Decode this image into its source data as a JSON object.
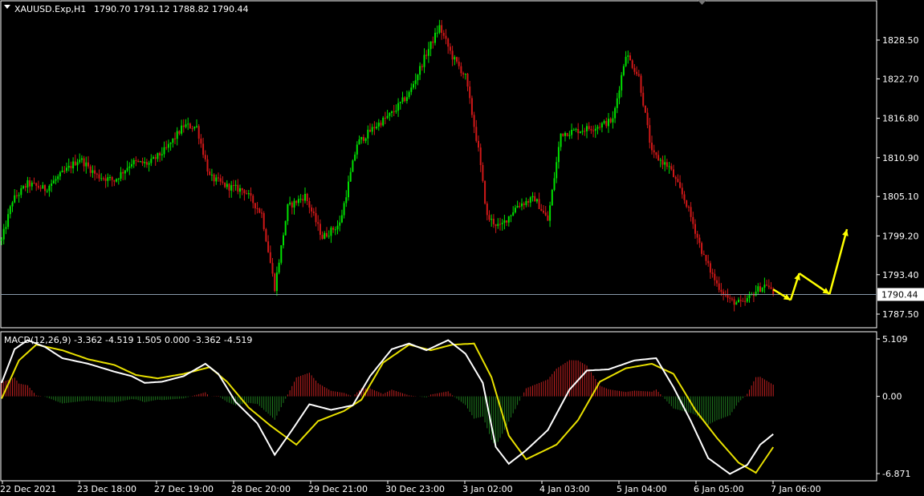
{
  "colors": {
    "background": "#000000",
    "frame": "#ffffff",
    "bull_candle": "#00e000",
    "bear_candle": "#d01818",
    "price_line": "#8899aa",
    "macd_line": "#ffffff",
    "signal_line": "#e8e000",
    "hist_positive": "#c02020",
    "hist_negative": "#1e7a1e",
    "arrow": "#ffff00",
    "price_tag_bg": "#ffffff",
    "price_tag_text": "#000000"
  },
  "header": {
    "symbol_tf": "XAUUSD.Exp,H1",
    "ohlc": "1790.70 1791.12 1788.82 1790.44"
  },
  "macd_header": "MACD(12,26,9) -3.362 -4.519 1.505 0.000 -3.362 -4.519",
  "current_price_tag": "1790.44",
  "price_axis_labels": [
    "1828.50",
    "1822.70",
    "1816.80",
    "1810.90",
    "1805.10",
    "1799.20",
    "1793.40",
    "1787.50"
  ],
  "macd_axis_labels": [
    "5.109",
    "0.00",
    "-6.871"
  ],
  "time_axis_labels": [
    "22 Dec 2021",
    "23 Dec 18:00",
    "27 Dec 19:00",
    "28 Dec 20:00",
    "29 Dec 21:00",
    "30 Dec 23:00",
    "3 Jan 02:00",
    "4 Jan 03:00",
    "5 Jan 04:00",
    "6 Jan 05:00",
    "7 Jan 06:00"
  ],
  "chart_data": [
    {
      "type": "candlestick",
      "symbol": "XAUUSD.Exp",
      "timeframe": "H1",
      "x_labels": [
        "22 Dec 2021",
        "23 Dec 18:00",
        "27 Dec 19:00",
        "28 Dec 20:00",
        "29 Dec 21:00",
        "30 Dec 23:00",
        "3 Jan 02:00",
        "4 Jan 03:00",
        "5 Jan 04:00",
        "6 Jan 05:00",
        "7 Jan 06:00"
      ],
      "ylim": [
        1785.7,
        1833.0
      ],
      "current_price": 1790.44,
      "close_path": [
        {
          "bar": 0,
          "close": 1798.5
        },
        {
          "bar": 5,
          "close": 1804.5
        },
        {
          "bar": 12,
          "close": 1807.0
        },
        {
          "bar": 20,
          "close": 1806.2
        },
        {
          "bar": 28,
          "close": 1808.5
        },
        {
          "bar": 36,
          "close": 1810.8
        },
        {
          "bar": 44,
          "close": 1808.2
        },
        {
          "bar": 52,
          "close": 1807.5
        },
        {
          "bar": 60,
          "close": 1810.2
        },
        {
          "bar": 68,
          "close": 1810.0
        },
        {
          "bar": 76,
          "close": 1812.2
        },
        {
          "bar": 84,
          "close": 1815.7
        },
        {
          "bar": 90,
          "close": 1815.5
        },
        {
          "bar": 96,
          "close": 1808.0
        },
        {
          "bar": 104,
          "close": 1806.6
        },
        {
          "bar": 112,
          "close": 1806.0
        },
        {
          "bar": 120,
          "close": 1802.5
        },
        {
          "bar": 126,
          "close": 1791.5
        },
        {
          "bar": 132,
          "close": 1803.5
        },
        {
          "bar": 140,
          "close": 1805.2
        },
        {
          "bar": 148,
          "close": 1799.0
        },
        {
          "bar": 156,
          "close": 1801.0
        },
        {
          "bar": 164,
          "close": 1813.0
        },
        {
          "bar": 172,
          "close": 1815.5
        },
        {
          "bar": 180,
          "close": 1817.5
        },
        {
          "bar": 188,
          "close": 1820.5
        },
        {
          "bar": 196,
          "close": 1826.5
        },
        {
          "bar": 202,
          "close": 1830.5
        },
        {
          "bar": 208,
          "close": 1826.0
        },
        {
          "bar": 214,
          "close": 1823.0
        },
        {
          "bar": 220,
          "close": 1812.0
        },
        {
          "bar": 224,
          "close": 1802.0
        },
        {
          "bar": 230,
          "close": 1800.5
        },
        {
          "bar": 238,
          "close": 1803.8
        },
        {
          "bar": 246,
          "close": 1804.8
        },
        {
          "bar": 252,
          "close": 1801.5
        },
        {
          "bar": 258,
          "close": 1814.5
        },
        {
          "bar": 266,
          "close": 1815.0
        },
        {
          "bar": 274,
          "close": 1815.5
        },
        {
          "bar": 282,
          "close": 1816.5
        },
        {
          "bar": 288,
          "close": 1826.5
        },
        {
          "bar": 294,
          "close": 1823.0
        },
        {
          "bar": 300,
          "close": 1811.5
        },
        {
          "bar": 308,
          "close": 1809.5
        },
        {
          "bar": 316,
          "close": 1804.0
        },
        {
          "bar": 324,
          "close": 1796.0
        },
        {
          "bar": 330,
          "close": 1792.0
        },
        {
          "bar": 336,
          "close": 1789.5
        },
        {
          "bar": 342,
          "close": 1789.0
        },
        {
          "bar": 348,
          "close": 1791.0
        },
        {
          "bar": 353,
          "close": 1792.0
        },
        {
          "bar": 356,
          "close": 1790.44
        }
      ],
      "forecast_arrow_path": [
        {
          "bar": 356,
          "price": 1791.2
        },
        {
          "bar": 364,
          "price": 1789.6
        },
        {
          "bar": 368,
          "price": 1793.6
        },
        {
          "bar": 382,
          "price": 1790.5
        },
        {
          "bar": 390,
          "price": 1800.2
        }
      ]
    },
    {
      "type": "line",
      "name": "MACD(12,26,9)",
      "ylim": [
        -6.871,
        5.109
      ],
      "current_values": {
        "macd": -3.362,
        "signal": -4.519
      },
      "series": [
        {
          "name": "macd",
          "points": [
            {
              "bar": 0,
              "value": 1.2
            },
            {
              "bar": 6,
              "value": 4.2
            },
            {
              "bar": 12,
              "value": 5.0
            },
            {
              "bar": 20,
              "value": 4.4
            },
            {
              "bar": 28,
              "value": 3.4
            },
            {
              "bar": 40,
              "value": 2.9
            },
            {
              "bar": 52,
              "value": 2.2
            },
            {
              "bar": 60,
              "value": 1.8
            },
            {
              "bar": 66,
              "value": 1.2
            },
            {
              "bar": 74,
              "value": 1.3
            },
            {
              "bar": 84,
              "value": 1.8
            },
            {
              "bar": 94,
              "value": 2.9
            },
            {
              "bar": 100,
              "value": 2.0
            },
            {
              "bar": 108,
              "value": -0.5
            },
            {
              "bar": 118,
              "value": -2.4
            },
            {
              "bar": 126,
              "value": -5.2
            },
            {
              "bar": 134,
              "value": -3.0
            },
            {
              "bar": 142,
              "value": -0.7
            },
            {
              "bar": 152,
              "value": -1.2
            },
            {
              "bar": 162,
              "value": -0.8
            },
            {
              "bar": 170,
              "value": 1.8
            },
            {
              "bar": 180,
              "value": 4.2
            },
            {
              "bar": 188,
              "value": 4.7
            },
            {
              "bar": 196,
              "value": 4.1
            },
            {
              "bar": 206,
              "value": 5.0
            },
            {
              "bar": 214,
              "value": 3.8
            },
            {
              "bar": 222,
              "value": 1.2
            },
            {
              "bar": 228,
              "value": -4.5
            },
            {
              "bar": 234,
              "value": -6.0
            },
            {
              "bar": 242,
              "value": -4.8
            },
            {
              "bar": 252,
              "value": -3.0
            },
            {
              "bar": 262,
              "value": 0.6
            },
            {
              "bar": 270,
              "value": 2.3
            },
            {
              "bar": 280,
              "value": 2.4
            },
            {
              "bar": 292,
              "value": 3.2
            },
            {
              "bar": 302,
              "value": 3.4
            },
            {
              "bar": 310,
              "value": 0.8
            },
            {
              "bar": 318,
              "value": -2.2
            },
            {
              "bar": 326,
              "value": -5.5
            },
            {
              "bar": 336,
              "value": -6.9
            },
            {
              "bar": 344,
              "value": -6.1
            },
            {
              "bar": 350,
              "value": -4.3
            },
            {
              "bar": 356,
              "value": -3.36
            }
          ]
        },
        {
          "name": "signal",
          "points": [
            {
              "bar": 0,
              "value": -0.2
            },
            {
              "bar": 8,
              "value": 3.2
            },
            {
              "bar": 16,
              "value": 4.6
            },
            {
              "bar": 28,
              "value": 4.1
            },
            {
              "bar": 40,
              "value": 3.3
            },
            {
              "bar": 52,
              "value": 2.8
            },
            {
              "bar": 62,
              "value": 1.9
            },
            {
              "bar": 72,
              "value": 1.6
            },
            {
              "bar": 84,
              "value": 2.0
            },
            {
              "bar": 96,
              "value": 2.6
            },
            {
              "bar": 104,
              "value": 1.3
            },
            {
              "bar": 114,
              "value": -1.0
            },
            {
              "bar": 124,
              "value": -2.6
            },
            {
              "bar": 136,
              "value": -4.3
            },
            {
              "bar": 146,
              "value": -2.2
            },
            {
              "bar": 158,
              "value": -1.3
            },
            {
              "bar": 166,
              "value": -0.3
            },
            {
              "bar": 176,
              "value": 3.0
            },
            {
              "bar": 188,
              "value": 4.6
            },
            {
              "bar": 198,
              "value": 4.1
            },
            {
              "bar": 208,
              "value": 4.6
            },
            {
              "bar": 218,
              "value": 4.7
            },
            {
              "bar": 226,
              "value": 1.7
            },
            {
              "bar": 234,
              "value": -3.5
            },
            {
              "bar": 242,
              "value": -5.6
            },
            {
              "bar": 256,
              "value": -4.3
            },
            {
              "bar": 266,
              "value": -2.1
            },
            {
              "bar": 276,
              "value": 1.3
            },
            {
              "bar": 288,
              "value": 2.5
            },
            {
              "bar": 300,
              "value": 2.9
            },
            {
              "bar": 310,
              "value": 2.0
            },
            {
              "bar": 320,
              "value": -1.2
            },
            {
              "bar": 330,
              "value": -3.7
            },
            {
              "bar": 340,
              "value": -5.9
            },
            {
              "bar": 348,
              "value": -6.8
            },
            {
              "bar": 356,
              "value": -4.52
            }
          ]
        }
      ]
    }
  ]
}
